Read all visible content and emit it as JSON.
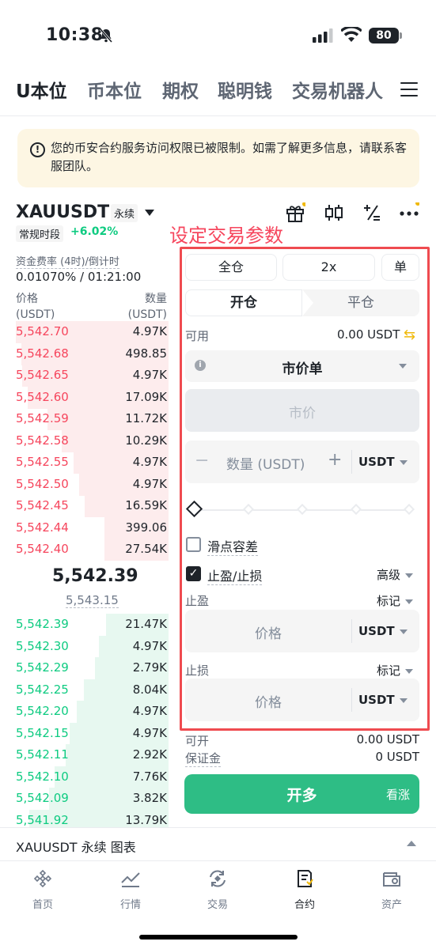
{
  "status": {
    "time": "10:38",
    "battery": "80"
  },
  "topnav": {
    "tabs": [
      "U本位",
      "币本位",
      "期权",
      "聪明钱",
      "交易机器人"
    ]
  },
  "notice": {
    "text": "您的币安合约服务访问权限已被限制。如需了解更多信息，请联系客服团队。"
  },
  "header": {
    "symbol": "XAUUSDT",
    "contract_type": "永续",
    "session": "常规时段",
    "change": "+6.02%",
    "annotation": "设定交易参数"
  },
  "funding": {
    "label": "资金费率 (4时)/倒计时",
    "value": "0.01070% / 01:21:00"
  },
  "orderbook": {
    "price_header": "价格",
    "price_unit": "(USDT)",
    "qty_header": "数量",
    "qty_unit": "(USDT)",
    "asks": [
      {
        "price": "5,542.70",
        "qty": "4.97K"
      },
      {
        "price": "5,542.68",
        "qty": "498.85"
      },
      {
        "price": "5,542.65",
        "qty": "4.97K"
      },
      {
        "price": "5,542.60",
        "qty": "17.09K"
      },
      {
        "price": "5,542.59",
        "qty": "11.72K"
      },
      {
        "price": "5,542.58",
        "qty": "10.29K"
      },
      {
        "price": "5,542.55",
        "qty": "4.97K"
      },
      {
        "price": "5,542.50",
        "qty": "4.97K"
      },
      {
        "price": "5,542.45",
        "qty": "16.59K"
      },
      {
        "price": "5,542.44",
        "qty": "399.06"
      },
      {
        "price": "5,542.40",
        "qty": "27.54K"
      }
    ],
    "last_price": "5,542.39",
    "mark_price": "5,543.15",
    "bids": [
      {
        "price": "5,542.39",
        "qty": "21.47K"
      },
      {
        "price": "5,542.30",
        "qty": "4.97K"
      },
      {
        "price": "5,542.29",
        "qty": "2.79K"
      },
      {
        "price": "5,542.25",
        "qty": "8.04K"
      },
      {
        "price": "5,542.20",
        "qty": "4.97K"
      },
      {
        "price": "5,542.15",
        "qty": "4.97K"
      },
      {
        "price": "5,542.11",
        "qty": "2.92K"
      },
      {
        "price": "5,542.10",
        "qty": "7.76K"
      },
      {
        "price": "5,542.09",
        "qty": "3.82K"
      },
      {
        "price": "5,541.92",
        "qty": "13.79K"
      }
    ]
  },
  "form": {
    "margin_mode": "全仓",
    "leverage": "2x",
    "position_mode": "单",
    "open_tab": "开仓",
    "close_tab": "平仓",
    "available_label": "可用",
    "available_value": "0.00 USDT",
    "order_type": "市价单",
    "price_placeholder": "市价",
    "qty_placeholder": "数量 (USDT)",
    "qty_unit": "USDT",
    "slippage_label": "滑点容差",
    "tpsl_label": "止盈/止损",
    "advanced_label": "高级",
    "tp_label": "止盈",
    "tp_trigger": "标记",
    "tp_price_placeholder": "价格",
    "tp_unit": "USDT",
    "sl_label": "止损",
    "sl_trigger": "标记",
    "sl_price_placeholder": "价格",
    "sl_unit": "USDT",
    "can_open_label": "可开",
    "can_open_value": "0.00 USDT",
    "margin_label": "保证金",
    "margin_value": "0 USDT",
    "open_long": "开多",
    "bullish": "看涨"
  },
  "chart_bar": {
    "title": "XAUUSDT 永续  图表"
  },
  "tabbar": {
    "items": [
      "首页",
      "行情",
      "交易",
      "合约",
      "资产"
    ],
    "active": "合约"
  }
}
